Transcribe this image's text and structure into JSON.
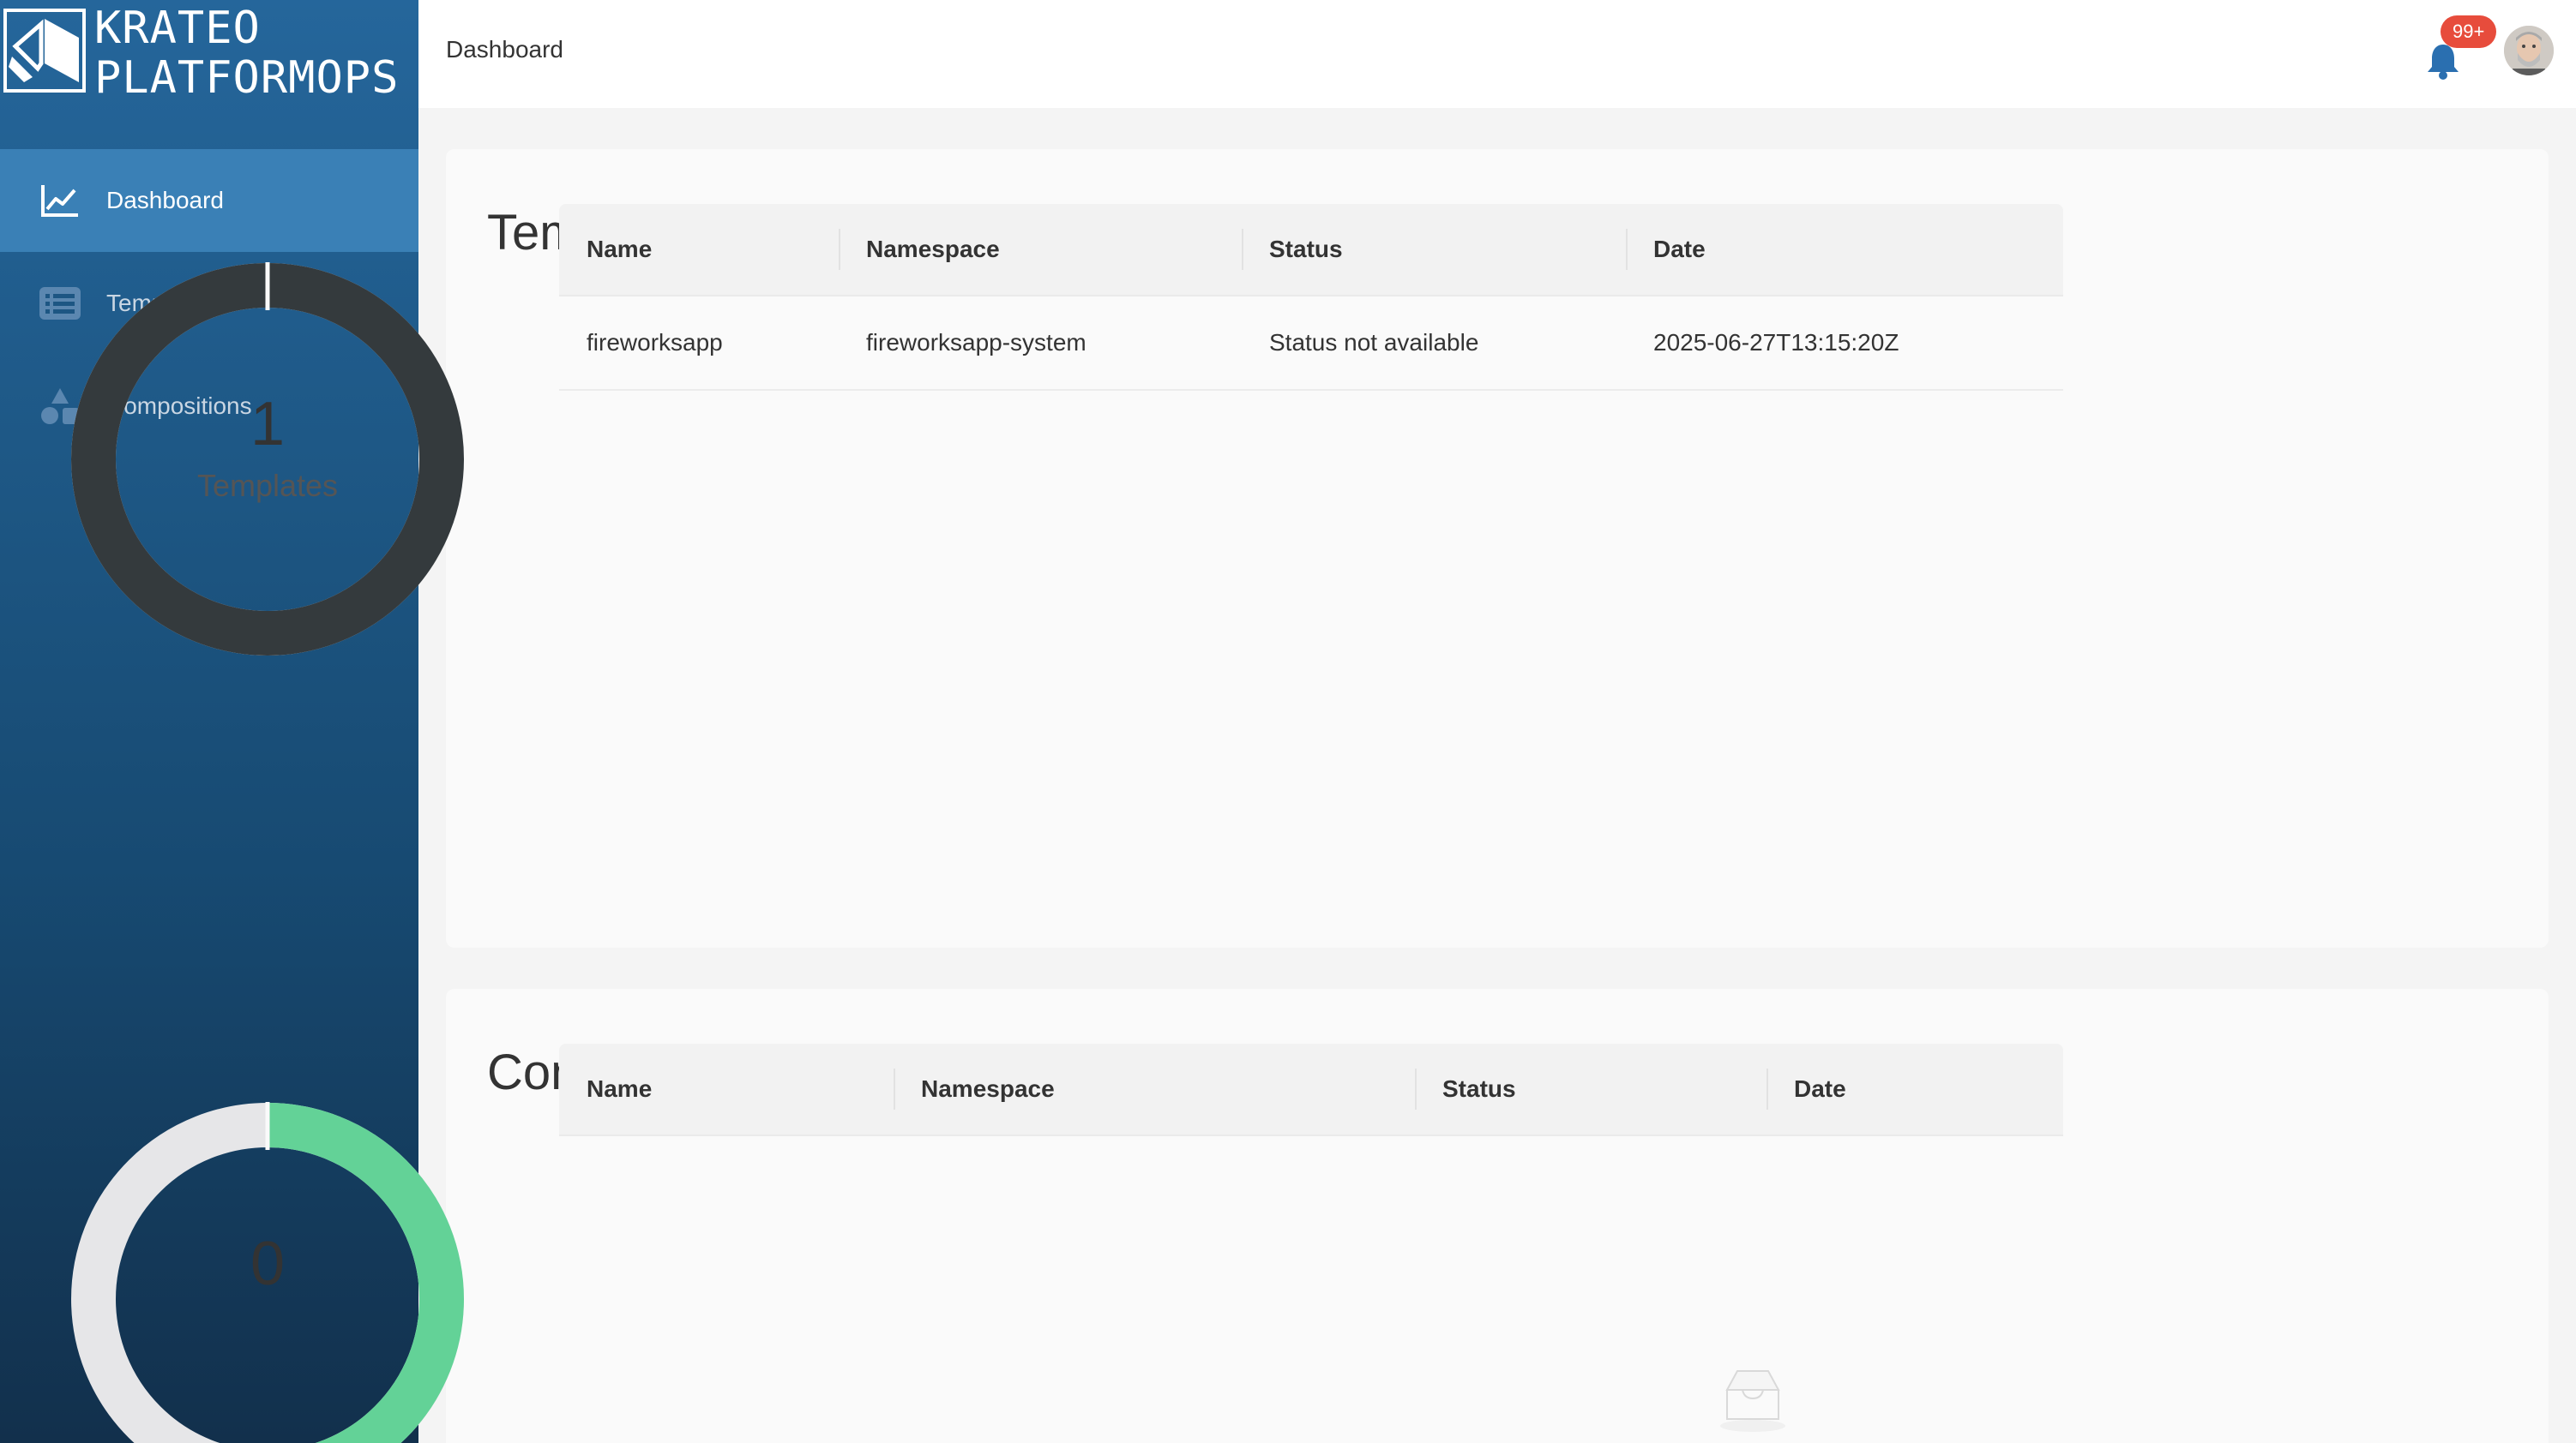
{
  "sidebar": {
    "logo": {
      "line1": "KRATEO",
      "line2": "PLATFORMOPS"
    },
    "items": [
      {
        "label": "Dashboard",
        "icon": "chart-line-icon",
        "active": true
      },
      {
        "label": "Templates",
        "icon": "list-icon",
        "active": false
      },
      {
        "label": "Compositions",
        "icon": "shapes-icon",
        "active": false
      }
    ]
  },
  "header": {
    "breadcrumb": "Dashboard",
    "notification_badge": "99+",
    "bell_icon": "bell-icon",
    "avatar_icon": "user-avatar"
  },
  "templates": {
    "title": "Templates",
    "donut": {
      "value": "1",
      "label": "Templates",
      "fraction": 1.0,
      "color": "#343a3d",
      "track_color": "#e8e8ea"
    },
    "table": {
      "columns": [
        "Name",
        "Namespace",
        "Status",
        "Date"
      ],
      "rows": [
        [
          "fireworksapp",
          "fireworksapp-system",
          "Status not available",
          "2025-06-27T13:15:20Z"
        ]
      ]
    }
  },
  "compositions": {
    "title": "Compositions",
    "donut": {
      "value": "0",
      "fraction": 0.5,
      "color": "#63d297",
      "track_color": "#e6e6e8"
    },
    "table": {
      "columns": [
        "Name",
        "Namespace",
        "Status",
        "Date"
      ],
      "rows": [],
      "empty_icon": "inbox-icon"
    }
  },
  "colors": {
    "sidebar_active": "#3a80b6",
    "badge": "#e74c3c",
    "bell": "#2a6fb0"
  }
}
